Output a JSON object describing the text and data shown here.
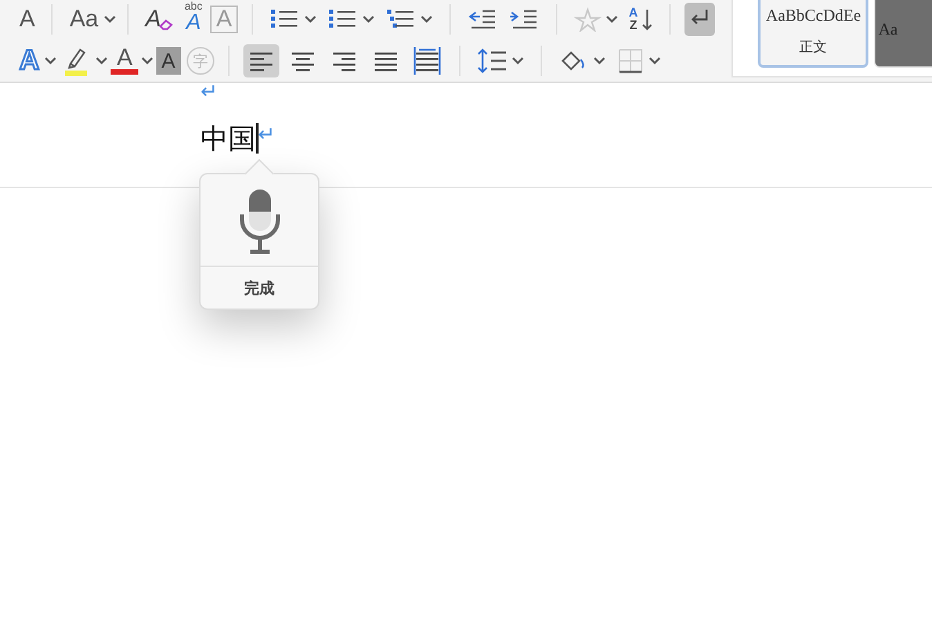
{
  "ribbon": {
    "row_1": [
      [
        {
          "kind": "grow",
          "glyph": "A"
        }
      ],
      [
        {
          "kind": "case",
          "glyph": "Aa"
        }
      ],
      [
        {
          "kind": "clear",
          "glyph": "A"
        },
        {
          "kind": "phonetic",
          "glyph": "A",
          "small": "abc"
        },
        {
          "kind": "boxed",
          "glyph": "A"
        }
      ],
      [
        {
          "kind": "bullets"
        },
        {
          "kind": "numbering"
        },
        {
          "kind": "multilevel"
        }
      ],
      [
        {
          "kind": "outdent"
        },
        {
          "kind": "indent"
        }
      ],
      [
        {
          "kind": "star"
        },
        {
          "kind": "sort",
          "glyph": "A",
          "small": "Z"
        }
      ],
      [
        {
          "kind": "marks",
          "on": true
        }
      ]
    ],
    "row_2": [
      [
        {
          "kind": "effects",
          "glyph": "A"
        },
        {
          "kind": "highlight"
        },
        {
          "kind": "fontcolor",
          "glyph": "A"
        },
        {
          "kind": "shade",
          "glyph": "A"
        },
        {
          "kind": "enclose",
          "glyph": "字"
        }
      ],
      [
        {
          "kind": "left",
          "selected": true
        },
        {
          "kind": "center",
          "selected": false
        },
        {
          "kind": "right",
          "selected": false
        },
        {
          "kind": "justify",
          "selected": false
        },
        {
          "kind": "distribute",
          "selected": false
        }
      ],
      [
        {
          "kind": "spacing"
        }
      ],
      [
        {
          "kind": "fill"
        },
        {
          "kind": "borders"
        }
      ]
    ]
  },
  "styles": [
    {
      "preview": "AaBbCcDdEe",
      "name": "正文",
      "selected": true
    },
    {
      "preview": "Aa",
      "selected": false
    }
  ],
  "document": {
    "paragraphs": [
      {
        "mark": "↵"
      },
      {
        "text": "中国",
        "mark": "↵",
        "cursor": true
      }
    ]
  },
  "dictation_popover": {
    "done_label": "完成"
  }
}
